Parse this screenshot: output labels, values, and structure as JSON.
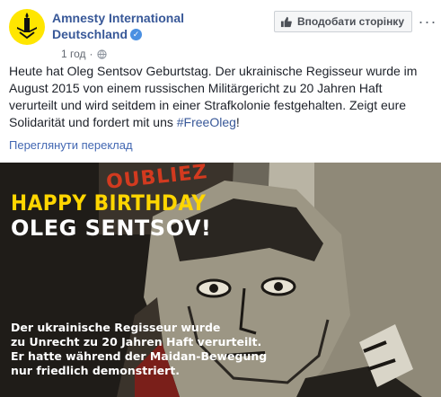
{
  "page": {
    "name_line1": "Amnesty International",
    "name_line2": "Deutschland",
    "time": "1 год",
    "like_button": "Вподобати сторінку",
    "more_glyph": "···"
  },
  "post": {
    "text": "Heute hat Oleg Sentsov Geburtstag. Der ukrainische Regisseur wurde im August 2015 von einem russischen Militärgericht zu 20 Jahren Haft verurteilt und wird seitdem in einer Strafkolonie festgehalten. Zeigt eure Solidarität und fordert mit uns ",
    "hashtag": "#FreeOleg",
    "text_end": "!",
    "translate_link": "Переглянути переклад"
  },
  "image": {
    "headline1": "HAPPY BIRTHDAY",
    "headline2": "OLEG SENTSOV!",
    "caption_lines": [
      "Der ukrainische Regisseur wurde",
      "zu Unrecht zu 20 Jahren Haft verurteilt.",
      "Er hatte während der Maidan-Bewegung",
      "nur friedlich demonstriert."
    ],
    "poster_text": "OUBLIEZ"
  },
  "colors": {
    "brand_yellow": "#ffe600",
    "link_blue": "#385898",
    "headline_yellow": "#ffd600"
  }
}
